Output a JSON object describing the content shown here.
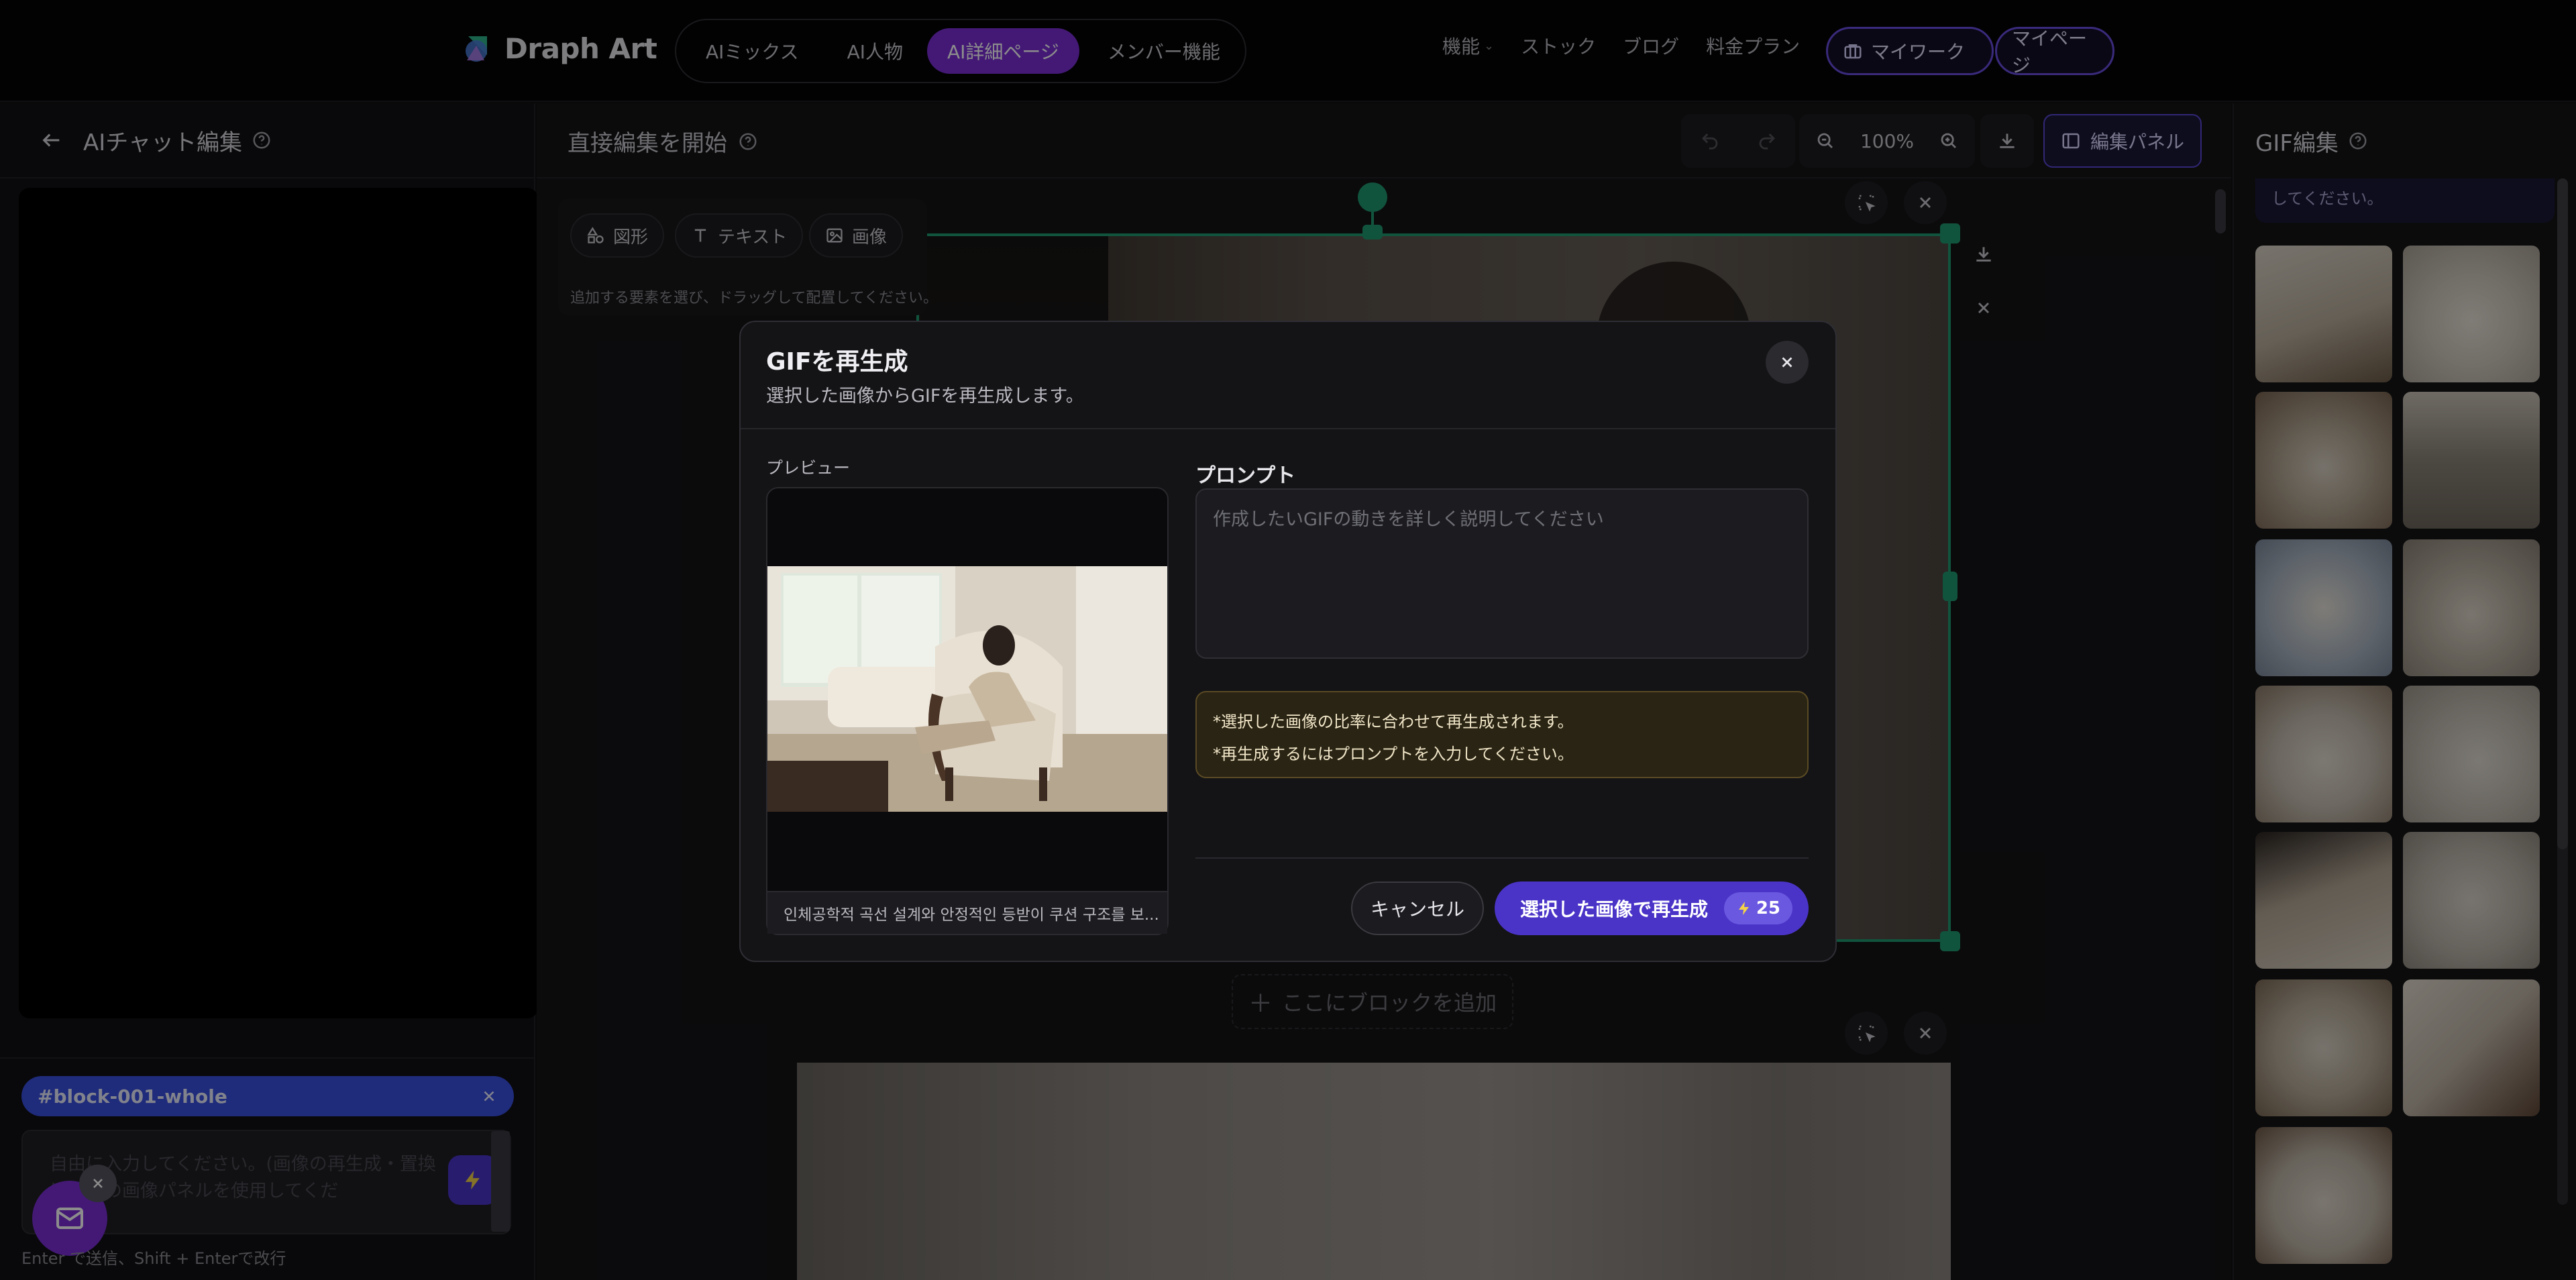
{
  "header": {
    "brand": "Draph Art",
    "tabs": [
      {
        "label": "AIミックス"
      },
      {
        "label": "AI人物"
      },
      {
        "label": "AI詳細ページ"
      },
      {
        "label": "メンバー機能"
      }
    ],
    "nav": {
      "features": "機能",
      "stock": "ストック",
      "blog": "ブログ",
      "pricing": "料金プラン"
    },
    "mywork_label": "マイワーク",
    "mypage_label": "マイページ",
    "accent": "#7a2fd6"
  },
  "left_panel": {
    "title": "AIチャット編集",
    "block_tag": "#block-001-whole",
    "input_placeholder": "自由に入力してください。(画像の再生成・置換は右側の画像パネルを使用してくだ",
    "hint": "Enter で送信、Shift + Enterで改行"
  },
  "editor": {
    "title": "直接編集を開始",
    "zoom": "100%",
    "edit_panel_label": "編集パネル",
    "toolbar": {
      "shape": "図形",
      "text": "テキスト",
      "image": "画像",
      "hint": "追加する要素を選び、ドラッグして配置してください。"
    },
    "add_block_label": "ここにブロックを追加",
    "selection_color": "#1f9a72"
  },
  "right_panel": {
    "title": "GIF編集",
    "note": "してください。",
    "thumbnail_count": 13
  },
  "modal": {
    "title": "GIFを再生成",
    "subtitle": "選択した画像からGIFを再生成します。",
    "preview_label": "プレビュー",
    "preview_caption": "인체공학적 곡선 설계와 안정적인 등받이 쿠션 구조를 보...",
    "prompt_label": "プロンプト",
    "prompt_placeholder": "作成したいGIFの動きを詳しく説明してください",
    "notices": [
      "*選択した画像の比率に合わせて再生成されます。",
      "*再生成するにはプロンプトを入力してください。"
    ],
    "cancel_label": "キャンセル",
    "regenerate_label": "選択した画像で再生成",
    "cost": "25",
    "primary_color": "#4a34c8"
  }
}
